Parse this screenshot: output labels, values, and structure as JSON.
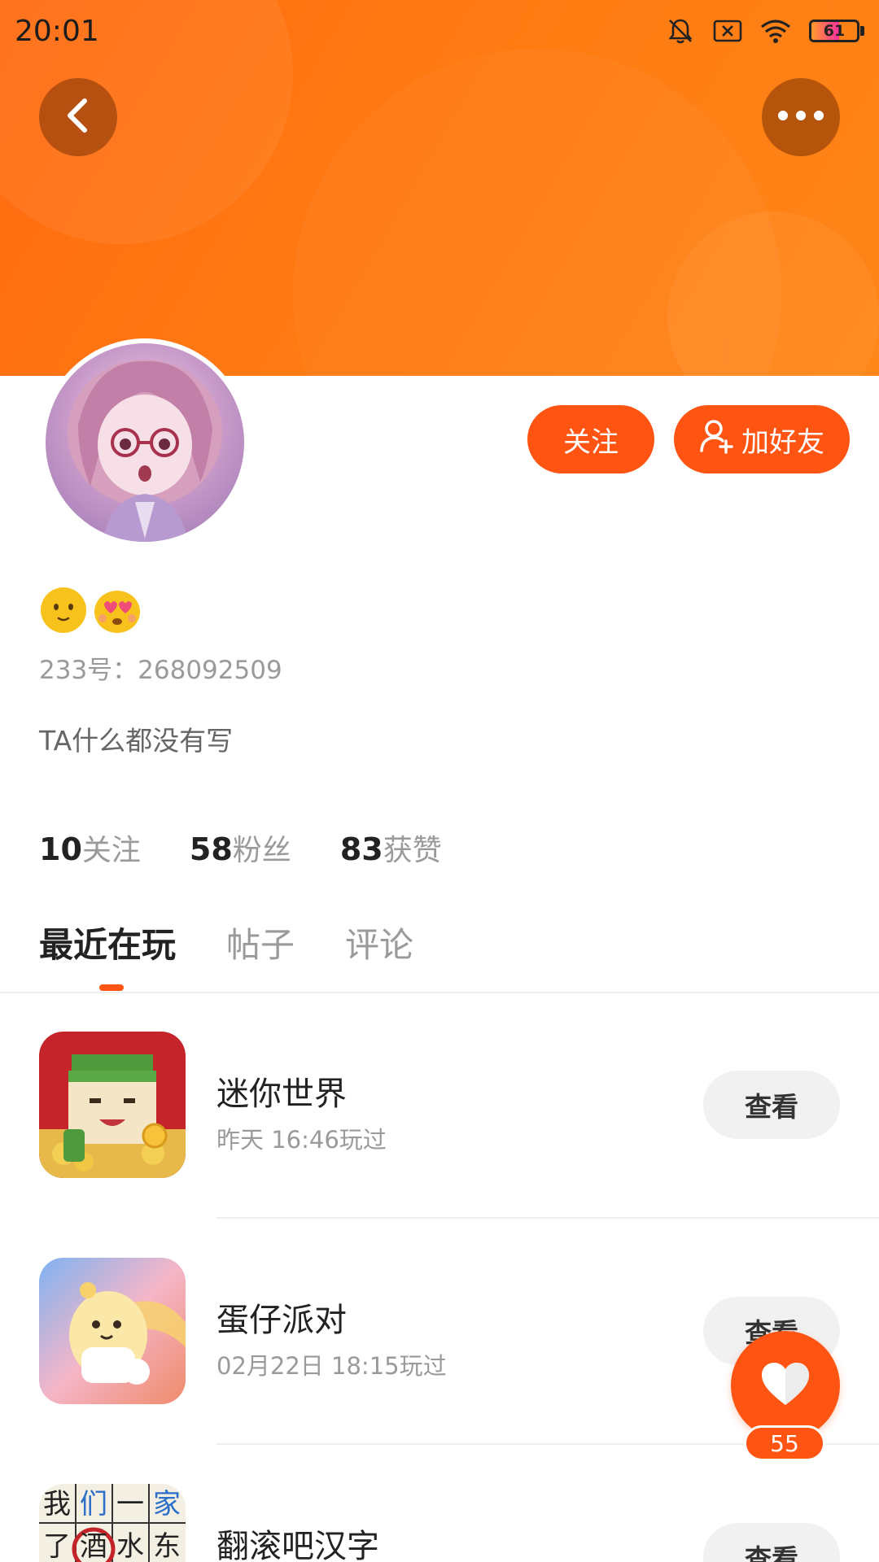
{
  "status_bar": {
    "time": "20:01",
    "battery_level": "61",
    "icons": [
      "mute-icon",
      "no-sim-icon",
      "wifi-icon",
      "battery-icon"
    ]
  },
  "header": {
    "back_icon": "chevron-left-icon",
    "more_icon": "more-horizontal-icon",
    "banner_color": "#ff7a12"
  },
  "profile": {
    "name_emojis": [
      "slight-smile-emoji",
      "heart-eyes-emoji"
    ],
    "id_text": "233号：268092509",
    "bio": "TA什么都没有写",
    "follow_label": "关注",
    "add_friend_label": "加好友"
  },
  "stats": [
    {
      "value": "10",
      "label": "关注"
    },
    {
      "value": "58",
      "label": "粉丝"
    },
    {
      "value": "83",
      "label": "获赞"
    }
  ],
  "tabs": [
    {
      "label": "最近在玩",
      "active": true
    },
    {
      "label": "帖子",
      "active": false
    },
    {
      "label": "评论",
      "active": false
    }
  ],
  "games": [
    {
      "name": "迷你世界",
      "last_played": "昨天 16:46玩过",
      "button": "查看"
    },
    {
      "name": "蛋仔派对",
      "last_played": "02月22日 18:15玩过",
      "button": "查看"
    },
    {
      "name": "翻滚吧汉字",
      "last_played": "",
      "button": "查看"
    }
  ],
  "word_game_icon_chars": [
    "我",
    "们",
    "一",
    "家",
    "了",
    "酒",
    "水",
    "东"
  ],
  "like": {
    "count": "55"
  },
  "colors": {
    "accent": "#ff5412",
    "text_primary": "#222222",
    "text_secondary": "#9a9a9a"
  }
}
